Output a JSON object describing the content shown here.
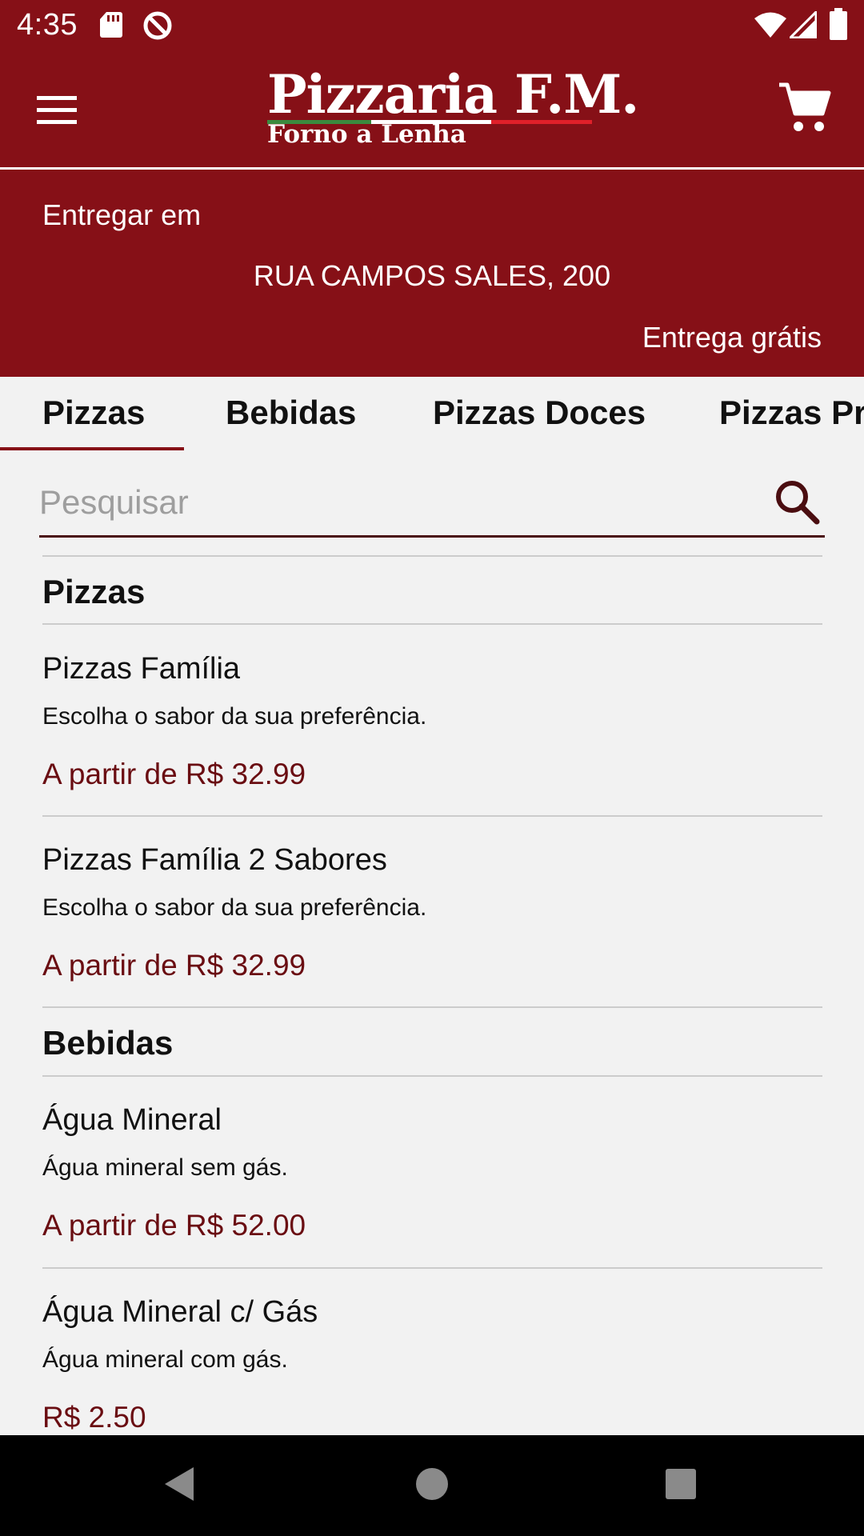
{
  "status_bar": {
    "time": "4:35",
    "left_icons": [
      "sd-card-icon",
      "data-saver-icon"
    ],
    "right_icons": [
      "wifi-icon",
      "signal-icon",
      "battery-icon"
    ]
  },
  "app_bar": {
    "logo_title": "Pizzaria F.M.",
    "logo_subtitle": "Forno a Lenha",
    "menu_icon": "menu-icon",
    "cart_icon": "cart-icon",
    "brand_color": "#861017"
  },
  "delivery": {
    "label": "Entregar em",
    "address": "RUA CAMPOS SALES, 200",
    "fee": "Entrega grátis"
  },
  "tabs": [
    {
      "label": "Pizzas",
      "selected": true
    },
    {
      "label": "Bebidas",
      "selected": false
    },
    {
      "label": "Pizzas Doces",
      "selected": false
    },
    {
      "label": "Pizzas Premium",
      "selected": false
    }
  ],
  "search": {
    "placeholder": "Pesquisar",
    "value": ""
  },
  "sections": [
    {
      "title": "Pizzas",
      "items": [
        {
          "name": "Pizzas Família",
          "description": "Escolha o sabor da sua preferência.",
          "price": "A partir de R$ 32.99"
        },
        {
          "name": "Pizzas Família 2 Sabores",
          "description": "Escolha o sabor da sua preferência.",
          "price": "A partir de R$ 32.99"
        }
      ]
    },
    {
      "title": "Bebidas",
      "items": [
        {
          "name": "Água Mineral",
          "description": "Água mineral sem gás.",
          "price": "A partir de R$ 52.00"
        },
        {
          "name": "Água Mineral c/ Gás",
          "description": "Água mineral com gás.",
          "price": "R$ 2.50"
        }
      ]
    }
  ],
  "nav_bar": {
    "icons": [
      "back-icon",
      "home-icon",
      "recents-icon"
    ]
  },
  "colors": {
    "price": "#6a0d12",
    "background": "#f2f2f2"
  }
}
